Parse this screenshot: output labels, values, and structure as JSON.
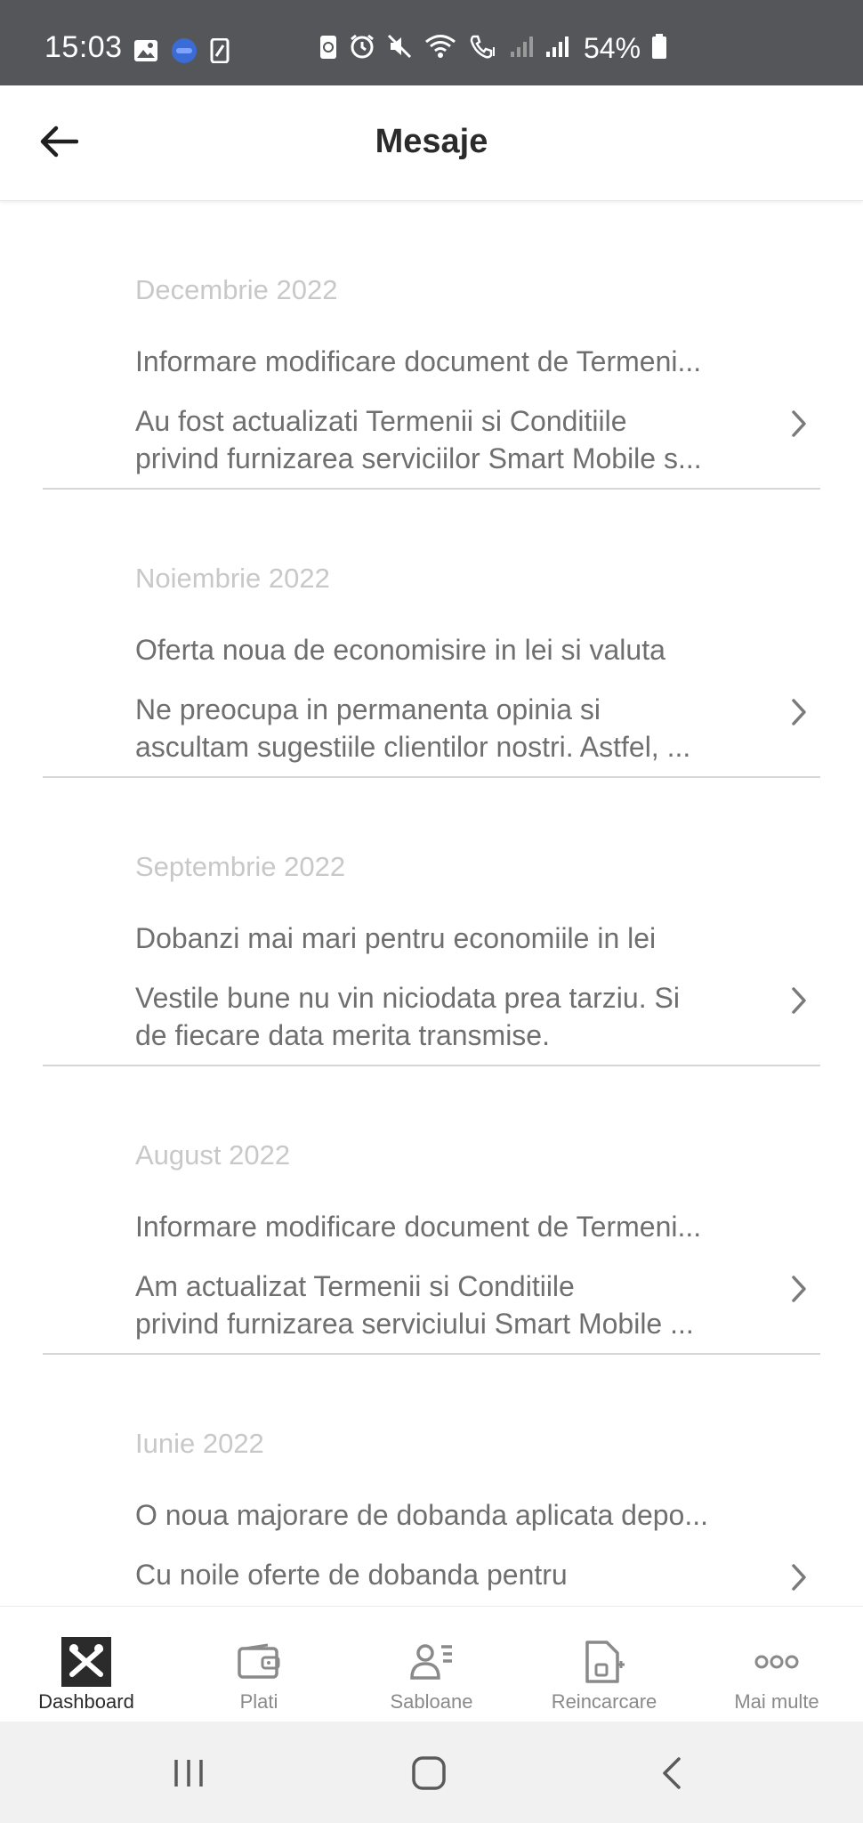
{
  "status_bar": {
    "time": "15:03",
    "battery": "54%",
    "left_icons": [
      "gallery-icon",
      "app-icon",
      "screenshot-icon"
    ],
    "right_icons": [
      "recycle-icon",
      "alarm-icon",
      "mute-icon",
      "wifi-icon",
      "wifi-call-icon",
      "signal-icon",
      "signal-icon"
    ]
  },
  "header": {
    "title": "Mesaje",
    "back_icon": "arrow-left-icon"
  },
  "messages": [
    {
      "month": "Decembrie 2022",
      "title": "Informare modificare document de Termeni...",
      "body_line1": "Au fost actualizati Termenii si Conditiile",
      "body_line2": "privind furnizarea serviciilor Smart Mobile s..."
    },
    {
      "month": "Noiembrie 2022",
      "title": "Oferta noua de economisire in lei si valuta",
      "body_line1": "Ne preocupa in permanenta opinia si",
      "body_line2": "ascultam sugestiile clientilor nostri. Astfel, ..."
    },
    {
      "month": "Septembrie 2022",
      "title": "Dobanzi mai mari pentru economiile in lei",
      "body_line1": "Vestile bune nu vin niciodata prea tarziu. Si",
      "body_line2": "de fiecare data merita transmise."
    },
    {
      "month": "August 2022",
      "title": "Informare modificare document de Termeni...",
      "body_line1": "Am actualizat Termenii si Conditiile",
      "body_line2": "privind furnizarea serviciului Smart Mobile ..."
    },
    {
      "month": "Iunie 2022",
      "title": "O noua majorare de dobanda aplicata depo...",
      "body_line1": "Cu noile oferte de dobanda pentru",
      "body_line2": ""
    }
  ],
  "bottom_nav": {
    "items": [
      {
        "label": "Dashboard",
        "icon": "dashboard-icon",
        "active": true
      },
      {
        "label": "Plati",
        "icon": "wallet-icon",
        "active": false
      },
      {
        "label": "Sabloane",
        "icon": "user-list-icon",
        "active": false
      },
      {
        "label": "Reincarcare",
        "icon": "document-plus-icon",
        "active": false
      },
      {
        "label": "Mai multe",
        "icon": "more-dots-icon",
        "active": false
      }
    ]
  },
  "system_nav": {
    "icons": [
      "recents-icon",
      "home-icon",
      "back-icon"
    ]
  },
  "colors": {
    "status_bar": "#55565a",
    "active_nav_bg": "#2b2b2b",
    "divider": "#d6d6d6",
    "month_text": "#c8c8c8",
    "message_text": "#6f6f6f"
  }
}
